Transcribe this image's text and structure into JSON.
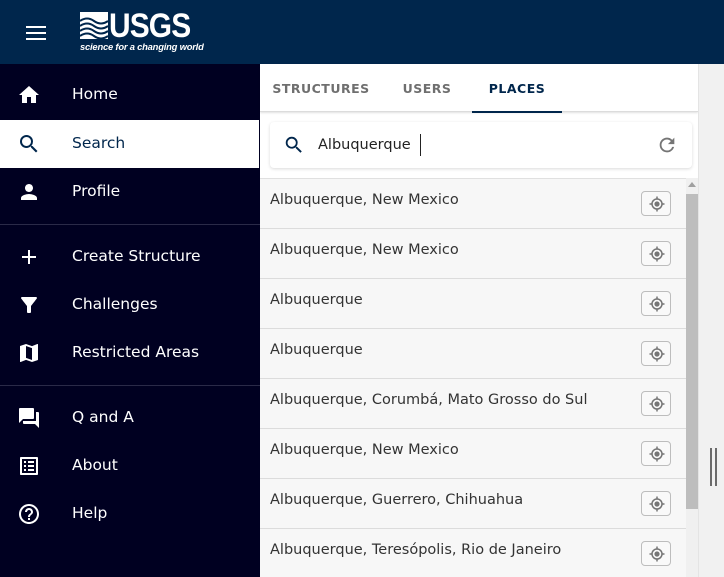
{
  "header": {
    "logo_text": "USGS",
    "logo_tagline": "science for a changing world",
    "menu_icon": "hamburger-menu-icon",
    "brand_color": "#00264c"
  },
  "sidebar": {
    "background": "#000021",
    "items": [
      {
        "label": "Home",
        "icon": "home-icon",
        "active": false
      },
      {
        "label": "Search",
        "icon": "search-icon",
        "active": true
      },
      {
        "label": "Profile",
        "icon": "person-icon",
        "active": false
      },
      {
        "label": "Create Structure",
        "icon": "plus-icon",
        "active": false
      },
      {
        "label": "Challenges",
        "icon": "filter-icon",
        "active": false
      },
      {
        "label": "Restricted Areas",
        "icon": "map-icon",
        "active": false
      },
      {
        "label": "Q and A",
        "icon": "forum-icon",
        "active": false
      },
      {
        "label": "About",
        "icon": "list-icon",
        "active": false
      },
      {
        "label": "Help",
        "icon": "help-circle-icon",
        "active": false
      }
    ]
  },
  "tabs": [
    {
      "label": "STRUCTURES",
      "active": false
    },
    {
      "label": "USERS",
      "active": false
    },
    {
      "label": "PLACES",
      "active": true
    }
  ],
  "search": {
    "value": "Albuquerque",
    "placeholder": "",
    "search_icon": "search-icon",
    "refresh_icon": "refresh-icon"
  },
  "results": [
    {
      "name": "Albuquerque, New Mexico",
      "action_icon": "locate-icon"
    },
    {
      "name": "Albuquerque, New Mexico",
      "action_icon": "locate-icon"
    },
    {
      "name": "Albuquerque",
      "action_icon": "locate-icon"
    },
    {
      "name": "Albuquerque",
      "action_icon": "locate-icon"
    },
    {
      "name": "Albuquerque, Corumbá, Mato Grosso do Sul",
      "action_icon": "locate-icon"
    },
    {
      "name": "Albuquerque, New Mexico",
      "action_icon": "locate-icon"
    },
    {
      "name": "Albuquerque, Guerrero, Chihuahua",
      "action_icon": "locate-icon"
    },
    {
      "name": "Albuquerque, Teresópolis, Rio de Janeiro",
      "action_icon": "locate-icon"
    }
  ]
}
